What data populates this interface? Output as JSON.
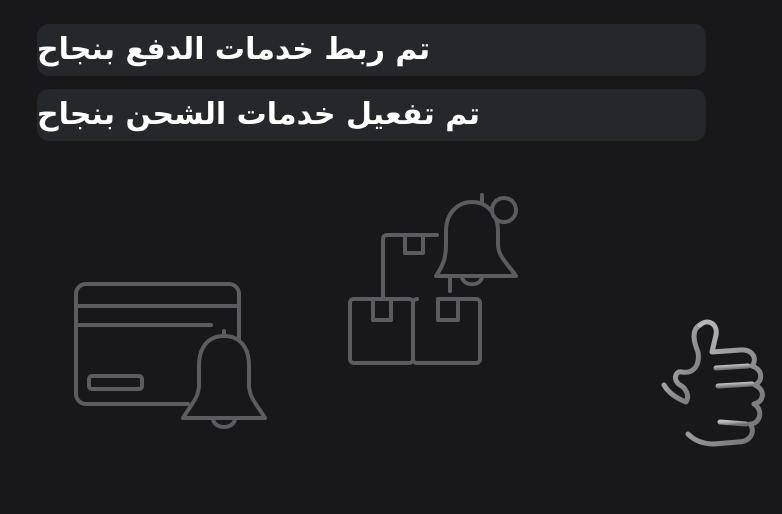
{
  "banners": {
    "payment": "تم ربط خدمات الدفع بنجاح",
    "shipping": "تم تفعيل خدمات الشحن بنجاح"
  },
  "icons": {
    "payment": "credit-card-bell-icon",
    "shipping": "boxes-bell-icon",
    "confirm": "thumbs-up-icon"
  },
  "colors": {
    "background": "#18181b",
    "banner": "#26272b",
    "text": "#ffffff",
    "icon_stroke": "#5c5c60"
  }
}
